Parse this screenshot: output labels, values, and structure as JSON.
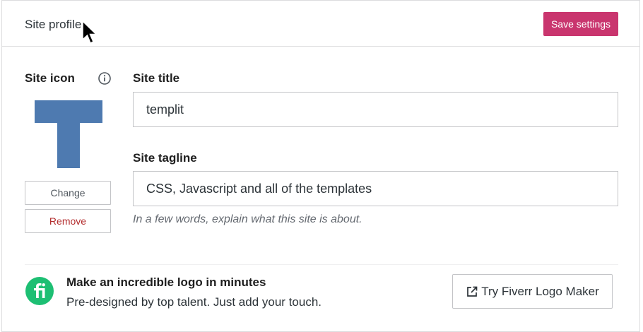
{
  "header": {
    "title": "Site profile",
    "save_label": "Save settings"
  },
  "site_icon": {
    "label": "Site icon",
    "info_icon": "info-icon",
    "logo_letter": "T",
    "change_label": "Change",
    "remove_label": "Remove"
  },
  "site_title": {
    "label": "Site title",
    "value": "templit"
  },
  "site_tagline": {
    "label": "Site tagline",
    "value": "CSS, Javascript and all of the templates",
    "hint": "In a few words, explain what this site is about."
  },
  "promo": {
    "icon": "fiverr-logo-icon",
    "title": "Make an incredible logo in minutes",
    "subtitle": "Pre-designed by top talent. Just add your touch.",
    "button_label": "Try Fiverr Logo Maker",
    "button_icon": "external-link-icon"
  },
  "colors": {
    "accent": "#c9356e",
    "logo_blue": "#4e7ab0",
    "fiverr_green": "#1dbf73",
    "remove_red": "#b32d2e"
  }
}
